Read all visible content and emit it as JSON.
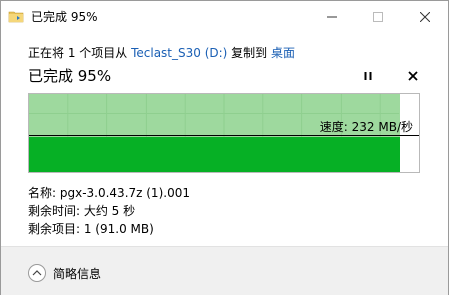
{
  "window": {
    "title": "已完成 95%"
  },
  "copy_info": {
    "prefix": "正在将 1 个项目从 ",
    "source": "Teclast_S30 (D:)",
    "middle": " 复制到 ",
    "destination": "桌面"
  },
  "progress": {
    "heading": "已完成 95%",
    "percent": 95,
    "speed_label": "速度: 232 MB/秒"
  },
  "details": {
    "name_label": "名称: pgx-3.0.43.7z (1).001",
    "time_label": "剩余时间: 大约 5 秒",
    "items_label": "剩余项目: 1 (91.0 MB)"
  },
  "footer": {
    "more_label": "简略信息"
  },
  "colors": {
    "progress_dark": "#06b025",
    "progress_light": "#9ed99e",
    "link": "#1a5fb4"
  },
  "icons": {
    "title": "folder-copy-icon",
    "pause": "pause-icon",
    "cancel": "close-icon",
    "collapse": "chevron-up-icon"
  }
}
